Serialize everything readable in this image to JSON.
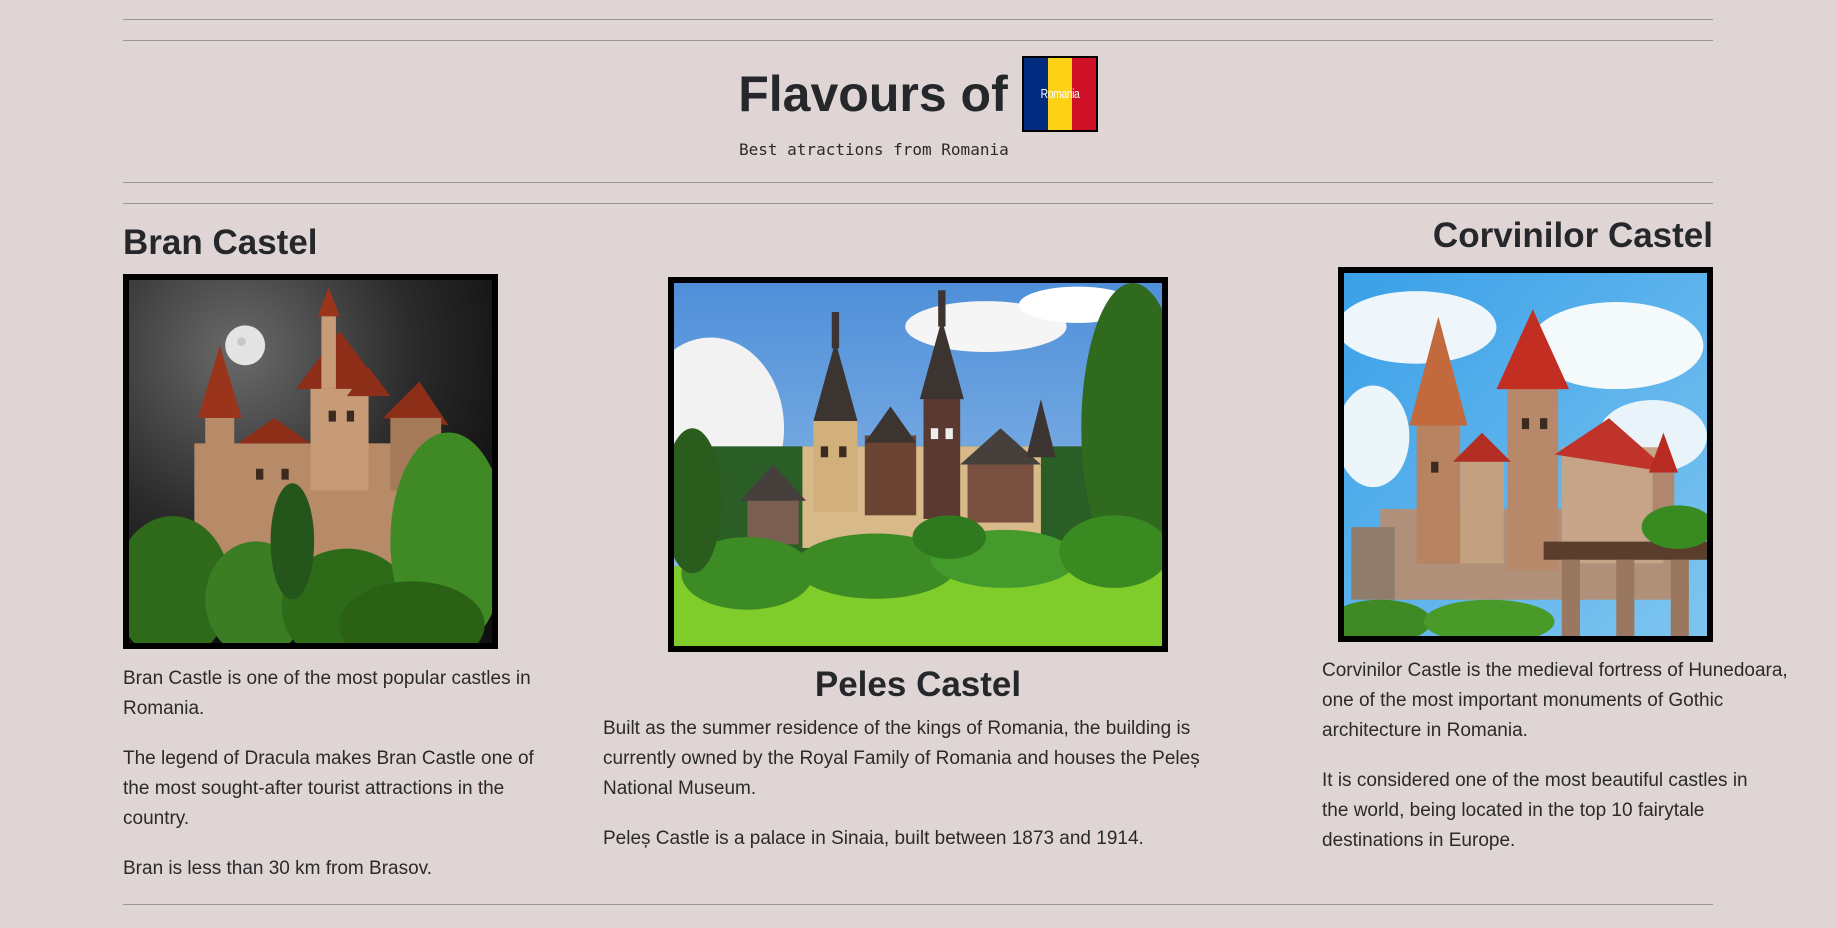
{
  "header": {
    "title": "Flavours of",
    "flag_text": "Romania",
    "subtitle": "Best atractions from Romania"
  },
  "colors": {
    "background": "#e0d5d5",
    "flag_blue": "#002b7f",
    "flag_yellow": "#fcd116",
    "flag_red": "#ce1126"
  },
  "castles": {
    "bran": {
      "title": "Bran Castel",
      "image": "bran-castle-night-moon-photo",
      "paragraphs": [
        "Bran Castle is one of the most popular castles in Romania.",
        "The legend of Dracula makes Bran Castle one of the most sought-after tourist attractions in the country.",
        "Bran is less than 30 km from Brasov."
      ]
    },
    "peles": {
      "title": "Peles Castel",
      "image": "peles-castle-forest-photo",
      "paragraphs": [
        "Built as the summer residence of the kings of Romania, the building is currently owned by the Royal Family of Romania and houses the Peleș National Museum.",
        "Peleș Castle is a palace in Sinaia, built between 1873 and 1914."
      ]
    },
    "corvinilor": {
      "title": "Corvinilor Castel",
      "image": "corvinilor-castle-blue-sky-photo",
      "paragraphs": [
        "Corvinilor Castle is the medieval fortress of Hunedoara, one of the most important monuments of Gothic architecture in Romania.",
        "It is considered one of the most beautiful castles in the world, being located in the top 10 fairytale destinations in Europe."
      ]
    }
  }
}
